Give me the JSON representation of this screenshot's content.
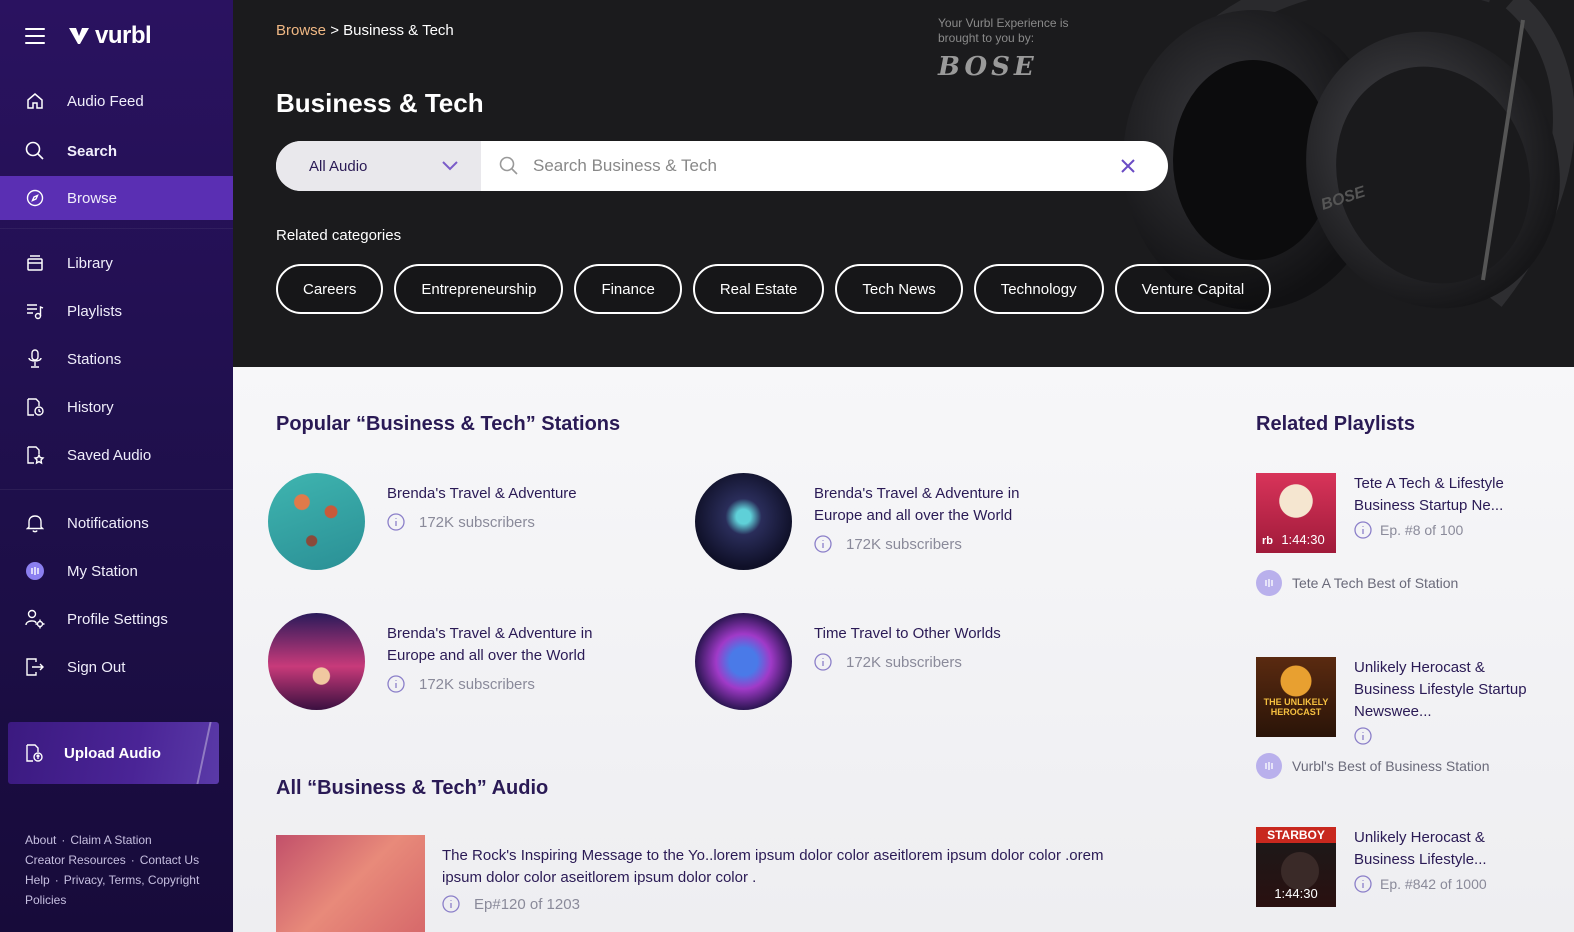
{
  "brand": {
    "name": "vurbl"
  },
  "sidebar": {
    "items": [
      {
        "label": "Audio Feed",
        "icon": "home-icon"
      },
      {
        "label": "Search",
        "icon": "search-icon"
      },
      {
        "label": "Browse",
        "icon": "compass-icon"
      },
      {
        "label": "Library",
        "icon": "library-icon"
      },
      {
        "label": "Playlists",
        "icon": "playlist-icon"
      },
      {
        "label": "Stations",
        "icon": "microphone-icon"
      },
      {
        "label": "History",
        "icon": "history-icon"
      },
      {
        "label": "Saved Audio",
        "icon": "saved-audio-icon"
      },
      {
        "label": "Notifications",
        "icon": "bell-icon"
      },
      {
        "label": "My Station",
        "icon": "station-avatar-icon"
      },
      {
        "label": "Profile Settings",
        "icon": "profile-settings-icon"
      },
      {
        "label": "Sign Out",
        "icon": "sign-out-icon"
      }
    ],
    "upload_label": "Upload Audio",
    "footer": {
      "about": "About",
      "claim": "Claim A Station",
      "creator": "Creator Resources",
      "contact": "Contact Us",
      "help": "Help",
      "privacy": "Privacy, Terms, Copyright Policies"
    }
  },
  "hero": {
    "breadcrumb": {
      "link": "Browse",
      "separator": ">",
      "current": "Business & Tech"
    },
    "title": "Business & Tech",
    "filter": {
      "selected": "All Audio"
    },
    "search": {
      "placeholder": "Search Business & Tech"
    },
    "related_label": "Related categories",
    "categories": [
      "Careers",
      "Entrepreneurship",
      "Finance",
      "Real Estate",
      "Tech News",
      "Technology",
      "Venture Capital"
    ],
    "sponsor_text": "Your Vurbl Experience is brought to you by:",
    "sponsor_brand": "BOSE"
  },
  "stations_section": {
    "title": "Popular “Business & Tech” Stations",
    "stations": [
      {
        "name": "Brenda's Travel & Adventure",
        "subscribers": "172K subscribers"
      },
      {
        "name": "Brenda's Travel & Adventure in Europe and all over the World",
        "subscribers": "172K subscribers"
      },
      {
        "name": "Brenda's Travel & Adventure in Europe and all over the World",
        "subscribers": "172K subscribers"
      },
      {
        "name": "Time Travel to Other Worlds",
        "subscribers": "172K subscribers"
      }
    ]
  },
  "audio_section": {
    "title": "All “Business & Tech” Audio",
    "items": [
      {
        "title": "The Rock's Inspiring Message to the Yo..lorem ipsum dolor color aseitlorem ipsum dolor color .orem ipsum dolor color aseitlorem ipsum dolor color .",
        "episode": "Ep#120 of 1203"
      }
    ]
  },
  "playlists_section": {
    "title": "Related Playlists",
    "items": [
      {
        "title": "Tete A Tech & Lifestyle Business Startup Ne...",
        "duration": "1:44:30",
        "episode": "Ep. #8 of 100",
        "source": "Tete A Tech Best of Station",
        "thumb_text": "rb"
      },
      {
        "title": "Unlikely Herocast & Business Lifestyle Startup Newswee...",
        "duration": "",
        "episode": "",
        "source": "Vurbl's Best of Business Station",
        "thumb_text": "THE UNLIKELY HEROCAST"
      },
      {
        "title": "Unlikely Herocast & Business Lifestyle...",
        "duration": "1:44:30",
        "episode": "Ep. #842 of 1000",
        "source": "",
        "thumb_text": "STARBOY"
      }
    ]
  },
  "colors": {
    "sidebar": "#2a1260",
    "active": "#5a2fb3",
    "hero": "#1b1b1d",
    "accent": "#f0b884",
    "text": "#2a1a55"
  }
}
